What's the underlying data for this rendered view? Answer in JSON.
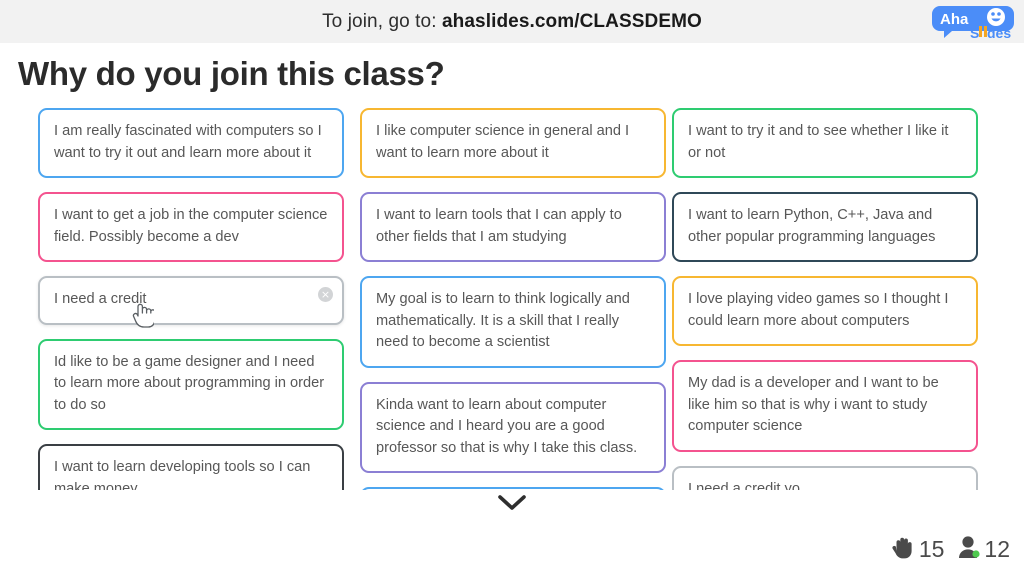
{
  "banner": {
    "prefix": "To join, go to: ",
    "url": "ahaslides.com/CLASSDEMO",
    "logo_name": "AhaSlides",
    "logo_word_1": "Aha",
    "logo_word_2": "Slides"
  },
  "title": "Why do you join this class?",
  "colors": {
    "banner_bg": "#f2f2f2",
    "blue": "#4da6f0",
    "pink": "#f4538f",
    "gray": "#b9bfc4",
    "green": "#2ecc71",
    "black": "#3a3f44",
    "orange": "#f7b731",
    "purple": "#8b7fd4",
    "navy": "#2f4858",
    "online_dot": "#4ec94e"
  },
  "columns": [
    {
      "name": "column-1",
      "cards": [
        {
          "text": "I am really fascinated with computers so I want to try it out and learn more about it",
          "color": "#4da6f0",
          "hovered": false
        },
        {
          "text": "I want to get a job in the computer science field. Possibly become a dev",
          "color": "#f4538f",
          "hovered": false
        },
        {
          "text": "I need a credit",
          "color": "#b9bfc4",
          "hovered": true
        },
        {
          "text": "Id like to be a game designer and I need to learn more about programming in order to do so",
          "color": "#2ecc71",
          "hovered": false
        },
        {
          "text": "I want to learn developing tools so I can make money",
          "color": "#3a3f44",
          "hovered": false
        }
      ]
    },
    {
      "name": "column-2",
      "cards": [
        {
          "text": "I like computer science in general and I want to learn more about it",
          "color": "#f7b731",
          "hovered": false
        },
        {
          "text": "I want to learn tools that I can apply to other fields that I am studying",
          "color": "#8b7fd4",
          "hovered": false
        },
        {
          "text": "My goal is to learn to think logically and mathematically. It is a skill that I really need to become a scientist",
          "color": "#4da6f0",
          "hovered": false
        },
        {
          "text": "Kinda want to learn about computer science and I heard you are a good professor so that is why I take this class.",
          "color": "#8b7fd4",
          "hovered": false
        },
        {
          "text": "",
          "color": "#4da6f0",
          "hovered": false
        }
      ]
    },
    {
      "name": "column-3",
      "cards": [
        {
          "text": "I want to try it and to see whether I like it or not",
          "color": "#2ecc71",
          "hovered": false
        },
        {
          "text": "I want to learn Python, C++, Java and other popular programming languages",
          "color": "#2f4858",
          "hovered": false
        },
        {
          "text": "I love playing video games so I thought I could learn more about computers",
          "color": "#f7b731",
          "hovered": false
        },
        {
          "text": "My dad is a developer and I want to be like him so that is why i want to study computer science",
          "color": "#f4538f",
          "hovered": false
        },
        {
          "text": "I need a credit yo",
          "color": "#b9bfc4",
          "hovered": false
        }
      ]
    }
  ],
  "card_close_label": "×",
  "scroll_down_icon": "chevron-down",
  "footer": {
    "raised_hands_count": "15",
    "participants_count": "12"
  }
}
